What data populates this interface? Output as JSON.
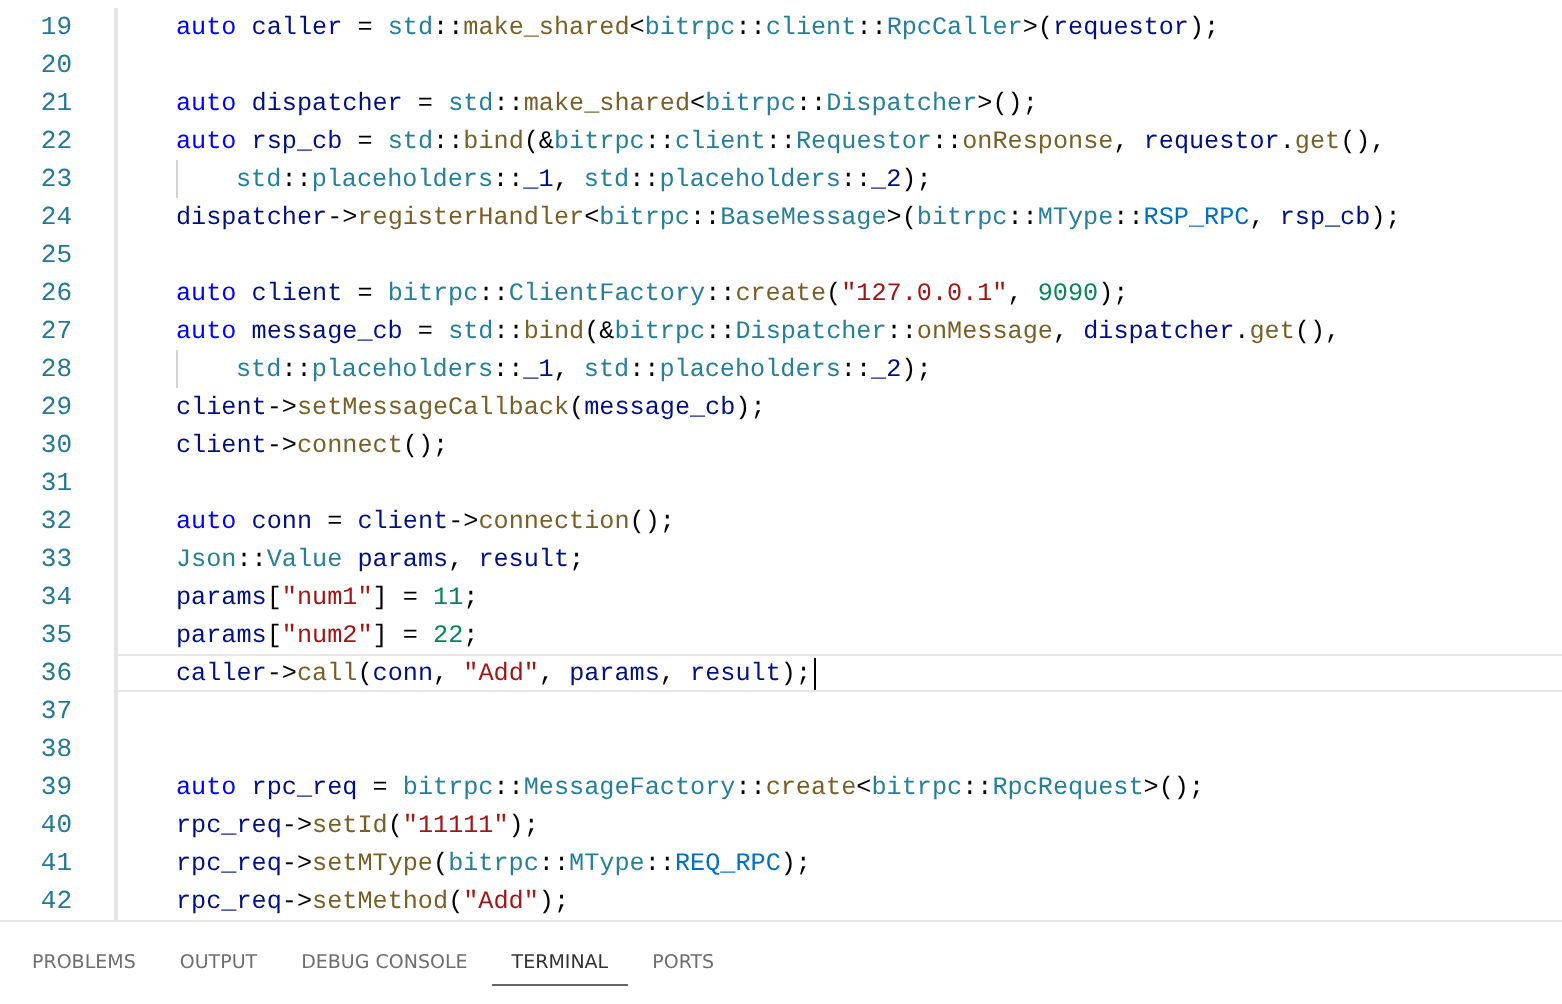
{
  "editor": {
    "lines": [
      {
        "number": "19",
        "cursor": false,
        "tokens": [
          {
            "kind": "kw",
            "text": "auto"
          },
          {
            "kind": "var",
            "text": " caller"
          },
          {
            "kind": "p",
            "text": " = "
          },
          {
            "kind": "type",
            "text": "std"
          },
          {
            "kind": "p",
            "text": "::"
          },
          {
            "kind": "fn",
            "text": "make_shared"
          },
          {
            "kind": "p",
            "text": "<"
          },
          {
            "kind": "type",
            "text": "bitrpc"
          },
          {
            "kind": "p",
            "text": "::"
          },
          {
            "kind": "type",
            "text": "client"
          },
          {
            "kind": "p",
            "text": "::"
          },
          {
            "kind": "type",
            "text": "RpcCaller"
          },
          {
            "kind": "p",
            "text": ">("
          },
          {
            "kind": "var",
            "text": "requestor"
          },
          {
            "kind": "p",
            "text": ");"
          }
        ]
      },
      {
        "number": "20",
        "cursor": false
      },
      {
        "number": "21",
        "cursor": false,
        "tokens": [
          {
            "kind": "kw",
            "text": "auto"
          },
          {
            "kind": "var",
            "text": " dispatcher"
          },
          {
            "kind": "p",
            "text": " = "
          },
          {
            "kind": "type",
            "text": "std"
          },
          {
            "kind": "p",
            "text": "::"
          },
          {
            "kind": "fn",
            "text": "make_shared"
          },
          {
            "kind": "p",
            "text": "<"
          },
          {
            "kind": "type",
            "text": "bitrpc"
          },
          {
            "kind": "p",
            "text": "::"
          },
          {
            "kind": "type",
            "text": "Dispatcher"
          },
          {
            "kind": "p",
            "text": ">();"
          }
        ]
      },
      {
        "number": "22",
        "cursor": false,
        "tokens": [
          {
            "kind": "kw",
            "text": "auto"
          },
          {
            "kind": "var",
            "text": " rsp_cb"
          },
          {
            "kind": "p",
            "text": " = "
          },
          {
            "kind": "type",
            "text": "std"
          },
          {
            "kind": "p",
            "text": "::"
          },
          {
            "kind": "fn",
            "text": "bind"
          },
          {
            "kind": "p",
            "text": "(&"
          },
          {
            "kind": "type",
            "text": "bitrpc"
          },
          {
            "kind": "p",
            "text": "::"
          },
          {
            "kind": "type",
            "text": "client"
          },
          {
            "kind": "p",
            "text": "::"
          },
          {
            "kind": "type",
            "text": "Requestor"
          },
          {
            "kind": "p",
            "text": "::"
          },
          {
            "kind": "fn",
            "text": "onResponse"
          },
          {
            "kind": "p",
            "text": ", "
          },
          {
            "kind": "var",
            "text": "requestor"
          },
          {
            "kind": "p",
            "text": "."
          },
          {
            "kind": "fn",
            "text": "get"
          },
          {
            "kind": "p",
            "text": "(),"
          }
        ],
        "children": [
          {
            "number": "23",
            "cursor": false,
            "tokens": [
              {
                "kind": "type",
                "text": "std"
              },
              {
                "kind": "p",
                "text": "::"
              },
              {
                "kind": "type",
                "text": "placeholders"
              },
              {
                "kind": "p",
                "text": "::"
              },
              {
                "kind": "var",
                "text": "_1"
              },
              {
                "kind": "p",
                "text": ", "
              },
              {
                "kind": "type",
                "text": "std"
              },
              {
                "kind": "p",
                "text": "::"
              },
              {
                "kind": "type",
                "text": "placeholders"
              },
              {
                "kind": "p",
                "text": "::"
              },
              {
                "kind": "var",
                "text": "_2"
              },
              {
                "kind": "p",
                "text": ");"
              }
            ]
          }
        ]
      },
      {
        "number": "24",
        "cursor": false,
        "tokens": [
          {
            "kind": "var",
            "text": "dispatcher"
          },
          {
            "kind": "p",
            "text": "->"
          },
          {
            "kind": "fn",
            "text": "registerHandler"
          },
          {
            "kind": "p",
            "text": "<"
          },
          {
            "kind": "type",
            "text": "bitrpc"
          },
          {
            "kind": "p",
            "text": "::"
          },
          {
            "kind": "type",
            "text": "BaseMessage"
          },
          {
            "kind": "p",
            "text": ">("
          },
          {
            "kind": "type",
            "text": "bitrpc"
          },
          {
            "kind": "p",
            "text": "::"
          },
          {
            "kind": "type",
            "text": "MType"
          },
          {
            "kind": "p",
            "text": "::"
          },
          {
            "kind": "enum",
            "text": "RSP_RPC"
          },
          {
            "kind": "p",
            "text": ", "
          },
          {
            "kind": "var",
            "text": "rsp_cb"
          },
          {
            "kind": "p",
            "text": ");"
          }
        ]
      },
      {
        "number": "25",
        "cursor": false
      },
      {
        "number": "26",
        "cursor": false,
        "tokens": [
          {
            "kind": "kw",
            "text": "auto"
          },
          {
            "kind": "var",
            "text": " client"
          },
          {
            "kind": "p",
            "text": " = "
          },
          {
            "kind": "type",
            "text": "bitrpc"
          },
          {
            "kind": "p",
            "text": "::"
          },
          {
            "kind": "type",
            "text": "ClientFactory"
          },
          {
            "kind": "p",
            "text": "::"
          },
          {
            "kind": "fn",
            "text": "create"
          },
          {
            "kind": "p",
            "text": "("
          },
          {
            "kind": "str",
            "text": "\"127.0.0.1\""
          },
          {
            "kind": "p",
            "text": ", "
          },
          {
            "kind": "num",
            "text": "9090"
          },
          {
            "kind": "p",
            "text": ");"
          }
        ]
      },
      {
        "number": "27",
        "cursor": false,
        "tokens": [
          {
            "kind": "kw",
            "text": "auto"
          },
          {
            "kind": "var",
            "text": " message_cb"
          },
          {
            "kind": "p",
            "text": " = "
          },
          {
            "kind": "type",
            "text": "std"
          },
          {
            "kind": "p",
            "text": "::"
          },
          {
            "kind": "fn",
            "text": "bind"
          },
          {
            "kind": "p",
            "text": "(&"
          },
          {
            "kind": "type",
            "text": "bitrpc"
          },
          {
            "kind": "p",
            "text": "::"
          },
          {
            "kind": "type",
            "text": "Dispatcher"
          },
          {
            "kind": "p",
            "text": "::"
          },
          {
            "kind": "fn",
            "text": "onMessage"
          },
          {
            "kind": "p",
            "text": ", "
          },
          {
            "kind": "var",
            "text": "dispatcher"
          },
          {
            "kind": "p",
            "text": "."
          },
          {
            "kind": "fn",
            "text": "get"
          },
          {
            "kind": "p",
            "text": "(),"
          }
        ],
        "children": [
          {
            "number": "28",
            "cursor": false,
            "tokens": [
              {
                "kind": "type",
                "text": "std"
              },
              {
                "kind": "p",
                "text": "::"
              },
              {
                "kind": "type",
                "text": "placeholders"
              },
              {
                "kind": "p",
                "text": "::"
              },
              {
                "kind": "var",
                "text": "_1"
              },
              {
                "kind": "p",
                "text": ", "
              },
              {
                "kind": "type",
                "text": "std"
              },
              {
                "kind": "p",
                "text": "::"
              },
              {
                "kind": "type",
                "text": "placeholders"
              },
              {
                "kind": "p",
                "text": "::"
              },
              {
                "kind": "var",
                "text": "_2"
              },
              {
                "kind": "p",
                "text": ");"
              }
            ]
          }
        ]
      },
      {
        "number": "29",
        "cursor": false,
        "tokens": [
          {
            "kind": "var",
            "text": "client"
          },
          {
            "kind": "p",
            "text": "->"
          },
          {
            "kind": "fn",
            "text": "setMessageCallback"
          },
          {
            "kind": "p",
            "text": "("
          },
          {
            "kind": "var",
            "text": "message_cb"
          },
          {
            "kind": "p",
            "text": ");"
          }
        ]
      },
      {
        "number": "30",
        "cursor": false,
        "tokens": [
          {
            "kind": "var",
            "text": "client"
          },
          {
            "kind": "p",
            "text": "->"
          },
          {
            "kind": "fn",
            "text": "connect"
          },
          {
            "kind": "p",
            "text": "();"
          }
        ]
      },
      {
        "number": "31",
        "cursor": false
      },
      {
        "number": "32",
        "cursor": false,
        "tokens": [
          {
            "kind": "kw",
            "text": "auto"
          },
          {
            "kind": "var",
            "text": " conn"
          },
          {
            "kind": "p",
            "text": " = "
          },
          {
            "kind": "var",
            "text": "client"
          },
          {
            "kind": "p",
            "text": "->"
          },
          {
            "kind": "fn",
            "text": "connection"
          },
          {
            "kind": "p",
            "text": "();"
          }
        ]
      },
      {
        "number": "33",
        "cursor": false,
        "tokens": [
          {
            "kind": "type",
            "text": "Json"
          },
          {
            "kind": "p",
            "text": "::"
          },
          {
            "kind": "type",
            "text": "Value"
          },
          {
            "kind": "var",
            "text": " params"
          },
          {
            "kind": "p",
            "text": ", "
          },
          {
            "kind": "var",
            "text": "result"
          },
          {
            "kind": "p",
            "text": ";"
          }
        ]
      },
      {
        "number": "34",
        "cursor": false,
        "tokens": [
          {
            "kind": "var",
            "text": "params"
          },
          {
            "kind": "p",
            "text": "["
          },
          {
            "kind": "str",
            "text": "\"num1\""
          },
          {
            "kind": "p",
            "text": "] = "
          },
          {
            "kind": "num",
            "text": "11"
          },
          {
            "kind": "p",
            "text": ";"
          }
        ]
      },
      {
        "number": "35",
        "cursor": false,
        "tokens": [
          {
            "kind": "var",
            "text": "params"
          },
          {
            "kind": "p",
            "text": "["
          },
          {
            "kind": "str",
            "text": "\"num2\""
          },
          {
            "kind": "p",
            "text": "] = "
          },
          {
            "kind": "num",
            "text": "22"
          },
          {
            "kind": "p",
            "text": ";"
          }
        ]
      },
      {
        "number": "36",
        "cursor": true,
        "tokens": [
          {
            "kind": "var",
            "text": "caller"
          },
          {
            "kind": "p",
            "text": "->"
          },
          {
            "kind": "fn",
            "text": "call"
          },
          {
            "kind": "p",
            "text": "("
          },
          {
            "kind": "var",
            "text": "conn"
          },
          {
            "kind": "p",
            "text": ", "
          },
          {
            "kind": "str",
            "text": "\"Add\""
          },
          {
            "kind": "p",
            "text": ", "
          },
          {
            "kind": "var",
            "text": "params"
          },
          {
            "kind": "p",
            "text": ", "
          },
          {
            "kind": "var",
            "text": "result"
          },
          {
            "kind": "p",
            "text": ");"
          }
        ]
      },
      {
        "number": "37",
        "cursor": false
      },
      {
        "number": "38",
        "cursor": false
      },
      {
        "number": "39",
        "cursor": false,
        "tokens": [
          {
            "kind": "kw",
            "text": "auto"
          },
          {
            "kind": "var",
            "text": " rpc_req"
          },
          {
            "kind": "p",
            "text": " = "
          },
          {
            "kind": "type",
            "text": "bitrpc"
          },
          {
            "kind": "p",
            "text": "::"
          },
          {
            "kind": "type",
            "text": "MessageFactory"
          },
          {
            "kind": "p",
            "text": "::"
          },
          {
            "kind": "fn",
            "text": "create"
          },
          {
            "kind": "p",
            "text": "<"
          },
          {
            "kind": "type",
            "text": "bitrpc"
          },
          {
            "kind": "p",
            "text": "::"
          },
          {
            "kind": "type",
            "text": "RpcRequest"
          },
          {
            "kind": "p",
            "text": ">();"
          }
        ]
      },
      {
        "number": "40",
        "cursor": false,
        "tokens": [
          {
            "kind": "var",
            "text": "rpc_req"
          },
          {
            "kind": "p",
            "text": "->"
          },
          {
            "kind": "fn",
            "text": "setId"
          },
          {
            "kind": "p",
            "text": "("
          },
          {
            "kind": "str",
            "text": "\"11111\""
          },
          {
            "kind": "p",
            "text": ");"
          }
        ]
      },
      {
        "number": "41",
        "cursor": false,
        "tokens": [
          {
            "kind": "var",
            "text": "rpc_req"
          },
          {
            "kind": "p",
            "text": "->"
          },
          {
            "kind": "fn",
            "text": "setMType"
          },
          {
            "kind": "p",
            "text": "("
          },
          {
            "kind": "type",
            "text": "bitrpc"
          },
          {
            "kind": "p",
            "text": "::"
          },
          {
            "kind": "type",
            "text": "MType"
          },
          {
            "kind": "p",
            "text": "::"
          },
          {
            "kind": "enum",
            "text": "REQ_RPC"
          },
          {
            "kind": "p",
            "text": ");"
          }
        ]
      },
      {
        "number": "42",
        "cursor": false,
        "tokens": [
          {
            "kind": "var",
            "text": "rpc_req"
          },
          {
            "kind": "p",
            "text": "->"
          },
          {
            "kind": "fn",
            "text": "setMethod"
          },
          {
            "kind": "p",
            "text": "("
          },
          {
            "kind": "str",
            "text": "\"Add\""
          },
          {
            "kind": "p",
            "text": ");"
          }
        ]
      }
    ]
  },
  "panel": {
    "tabs": [
      {
        "label": "PROBLEMS",
        "selected": false
      },
      {
        "label": "OUTPUT",
        "selected": false
      },
      {
        "label": "DEBUG CONSOLE",
        "selected": false
      },
      {
        "label": "TERMINAL",
        "selected": true
      },
      {
        "label": "PORTS",
        "selected": false
      }
    ]
  }
}
